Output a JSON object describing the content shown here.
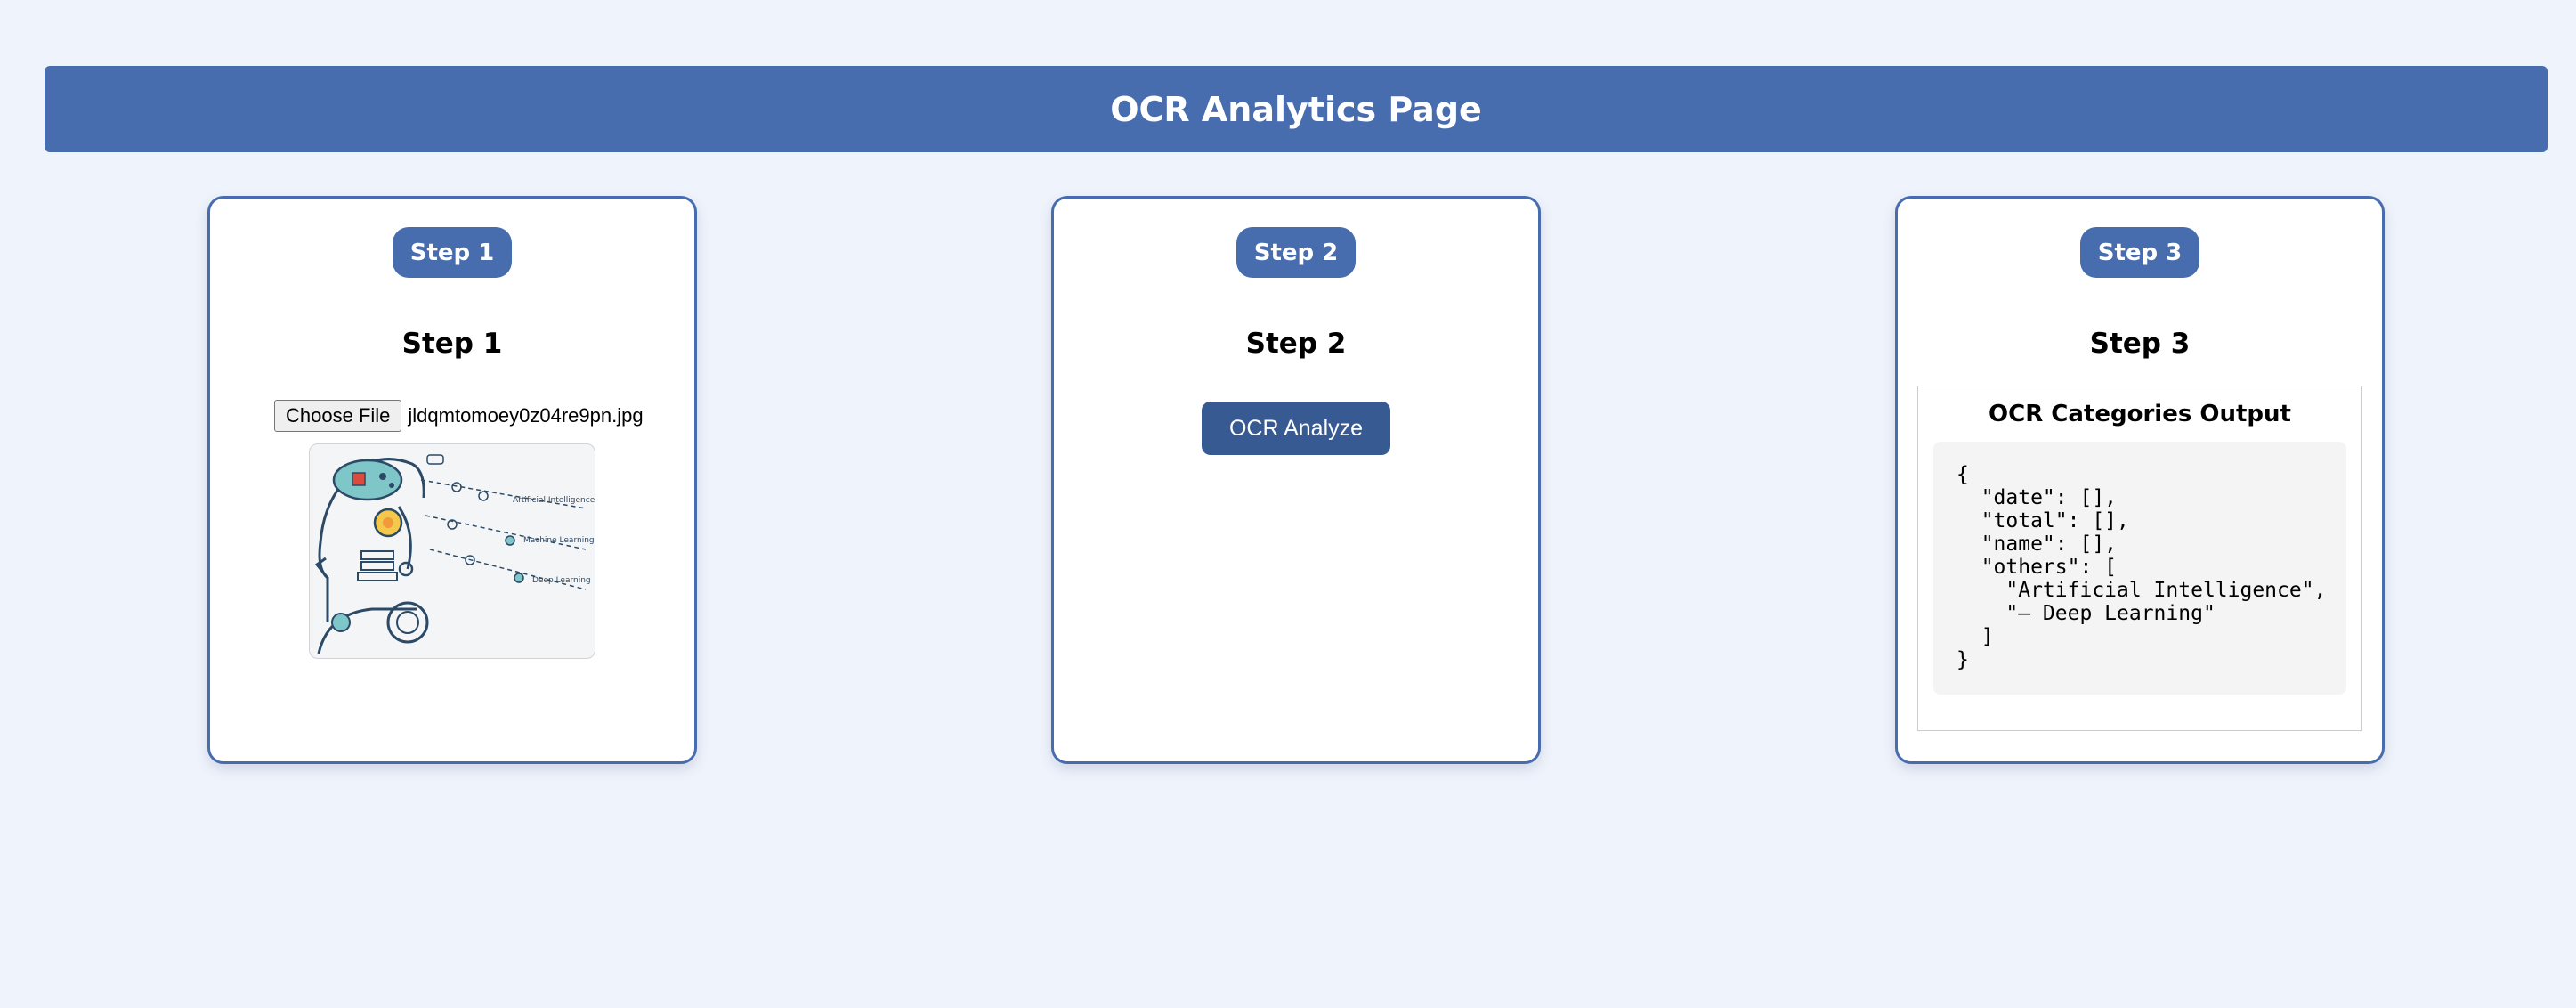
{
  "header": {
    "title": "OCR Analytics Page"
  },
  "steps": [
    {
      "badge": "Step 1",
      "title": "Step 1",
      "file_button": "Choose File",
      "file_name": "jldqmtomoey0z04re9pn.jpg",
      "preview_labels": [
        "Artificial Intelligence",
        "Machine Learning",
        "Deep Learning"
      ]
    },
    {
      "badge": "Step 2",
      "title": "Step 2",
      "analyze_button": "OCR Analyze"
    },
    {
      "badge": "Step 3",
      "title": "Step 3",
      "output_title": "OCR Categories Output",
      "output_json": "{\n  \"date\": [],\n  \"total\": [],\n  \"name\": [],\n  \"others\": [\n    \"Artificial Intelligence\",\n    \"— Deep Learning\"\n  ]\n}"
    }
  ],
  "colors": {
    "accent": "#476daf",
    "button": "#375a92",
    "background": "#eff3fb"
  }
}
